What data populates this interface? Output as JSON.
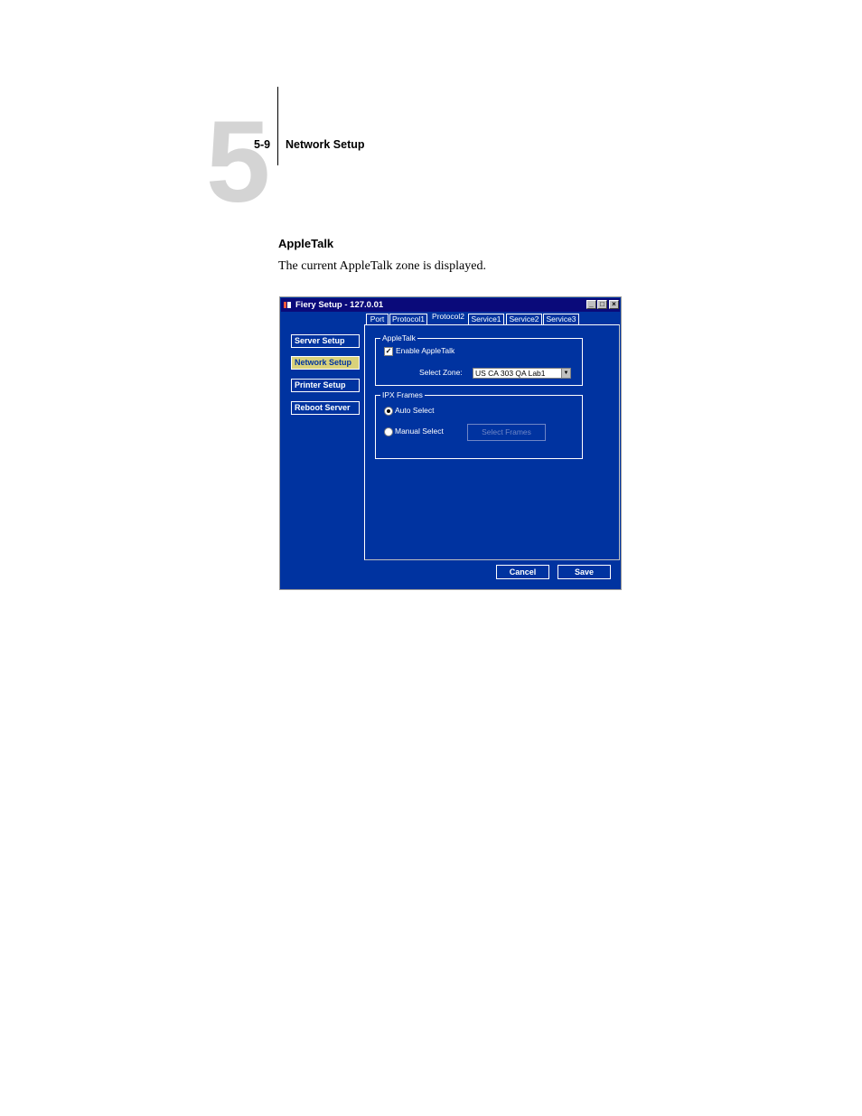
{
  "header": {
    "chapter_number": "5",
    "page_number": "5-9",
    "chapter_title": "Network Setup"
  },
  "section": {
    "title": "AppleTalk",
    "body": "The current AppleTalk zone is displayed."
  },
  "window": {
    "title": "Fiery Setup - 127.0.01",
    "controls": {
      "minimize": "_",
      "maximize": "□",
      "close": "×"
    },
    "nav": [
      {
        "label": "Server Setup"
      },
      {
        "label": "Network Setup",
        "active": true
      },
      {
        "label": "Printer Setup"
      },
      {
        "label": "Reboot Server"
      }
    ],
    "tabs": [
      {
        "label": "Port"
      },
      {
        "label": "Protocol1"
      },
      {
        "label": "Protocol2",
        "active": true
      },
      {
        "label": "Service1"
      },
      {
        "label": "Service2"
      },
      {
        "label": "Service3"
      }
    ],
    "appletalk_group": {
      "label": "AppleTalk",
      "enable_label": "Enable AppleTalk",
      "enable_checked": true,
      "zone_label": "Select Zone:",
      "zone_value": "US CA 303 QA Lab1"
    },
    "ipx_group": {
      "label": "IPX Frames",
      "auto_label": "Auto Select",
      "manual_label": "Manual Select",
      "selected": "auto",
      "select_frames_label": "Select Frames"
    },
    "buttons": {
      "cancel": "Cancel",
      "save": "Save"
    },
    "colors": {
      "background": "#0033a0",
      "titlebar": "#0a0a7a",
      "active_nav": "#d9d27a"
    }
  }
}
